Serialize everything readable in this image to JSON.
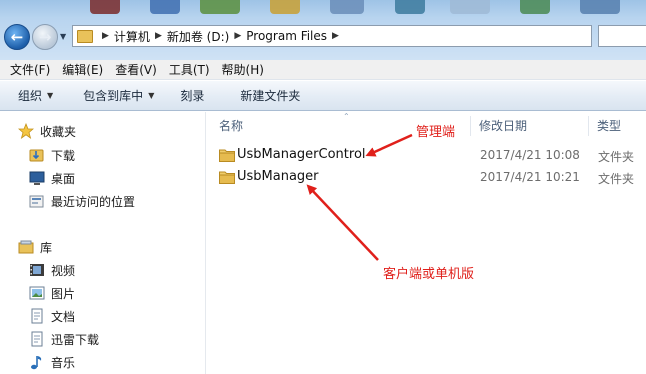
{
  "address_bar": {
    "breadcrumbs": [
      "计算机",
      "新加卷 (D:)",
      "Program Files"
    ]
  },
  "menu": [
    "文件(F)",
    "编辑(E)",
    "查看(V)",
    "工具(T)",
    "帮助(H)"
  ],
  "toolbar": {
    "organize": "组织",
    "include_in_library": "包含到库中",
    "burn": "刻录",
    "new_folder": "新建文件夹"
  },
  "nav": {
    "favorites": {
      "label": "收藏夹",
      "items": [
        "下载",
        "桌面",
        "最近访问的位置"
      ]
    },
    "libraries": {
      "label": "库",
      "items": [
        "视频",
        "图片",
        "文档",
        "迅雷下载",
        "音乐"
      ]
    }
  },
  "columns": {
    "name": "名称",
    "modified": "修改日期",
    "type": "类型"
  },
  "files": [
    {
      "name": "UsbManagerControl",
      "modified": "2017/4/21 10:08",
      "type": "文件夹"
    },
    {
      "name": "UsbManager",
      "modified": "2017/4/21 10:21",
      "type": "文件夹"
    }
  ],
  "annotations": {
    "manager": "管理端",
    "client": "客户端或单机版"
  },
  "colors": {
    "annotation": "#e0201b",
    "folder": "#e9c25a",
    "accent": "#1d5ea9"
  }
}
